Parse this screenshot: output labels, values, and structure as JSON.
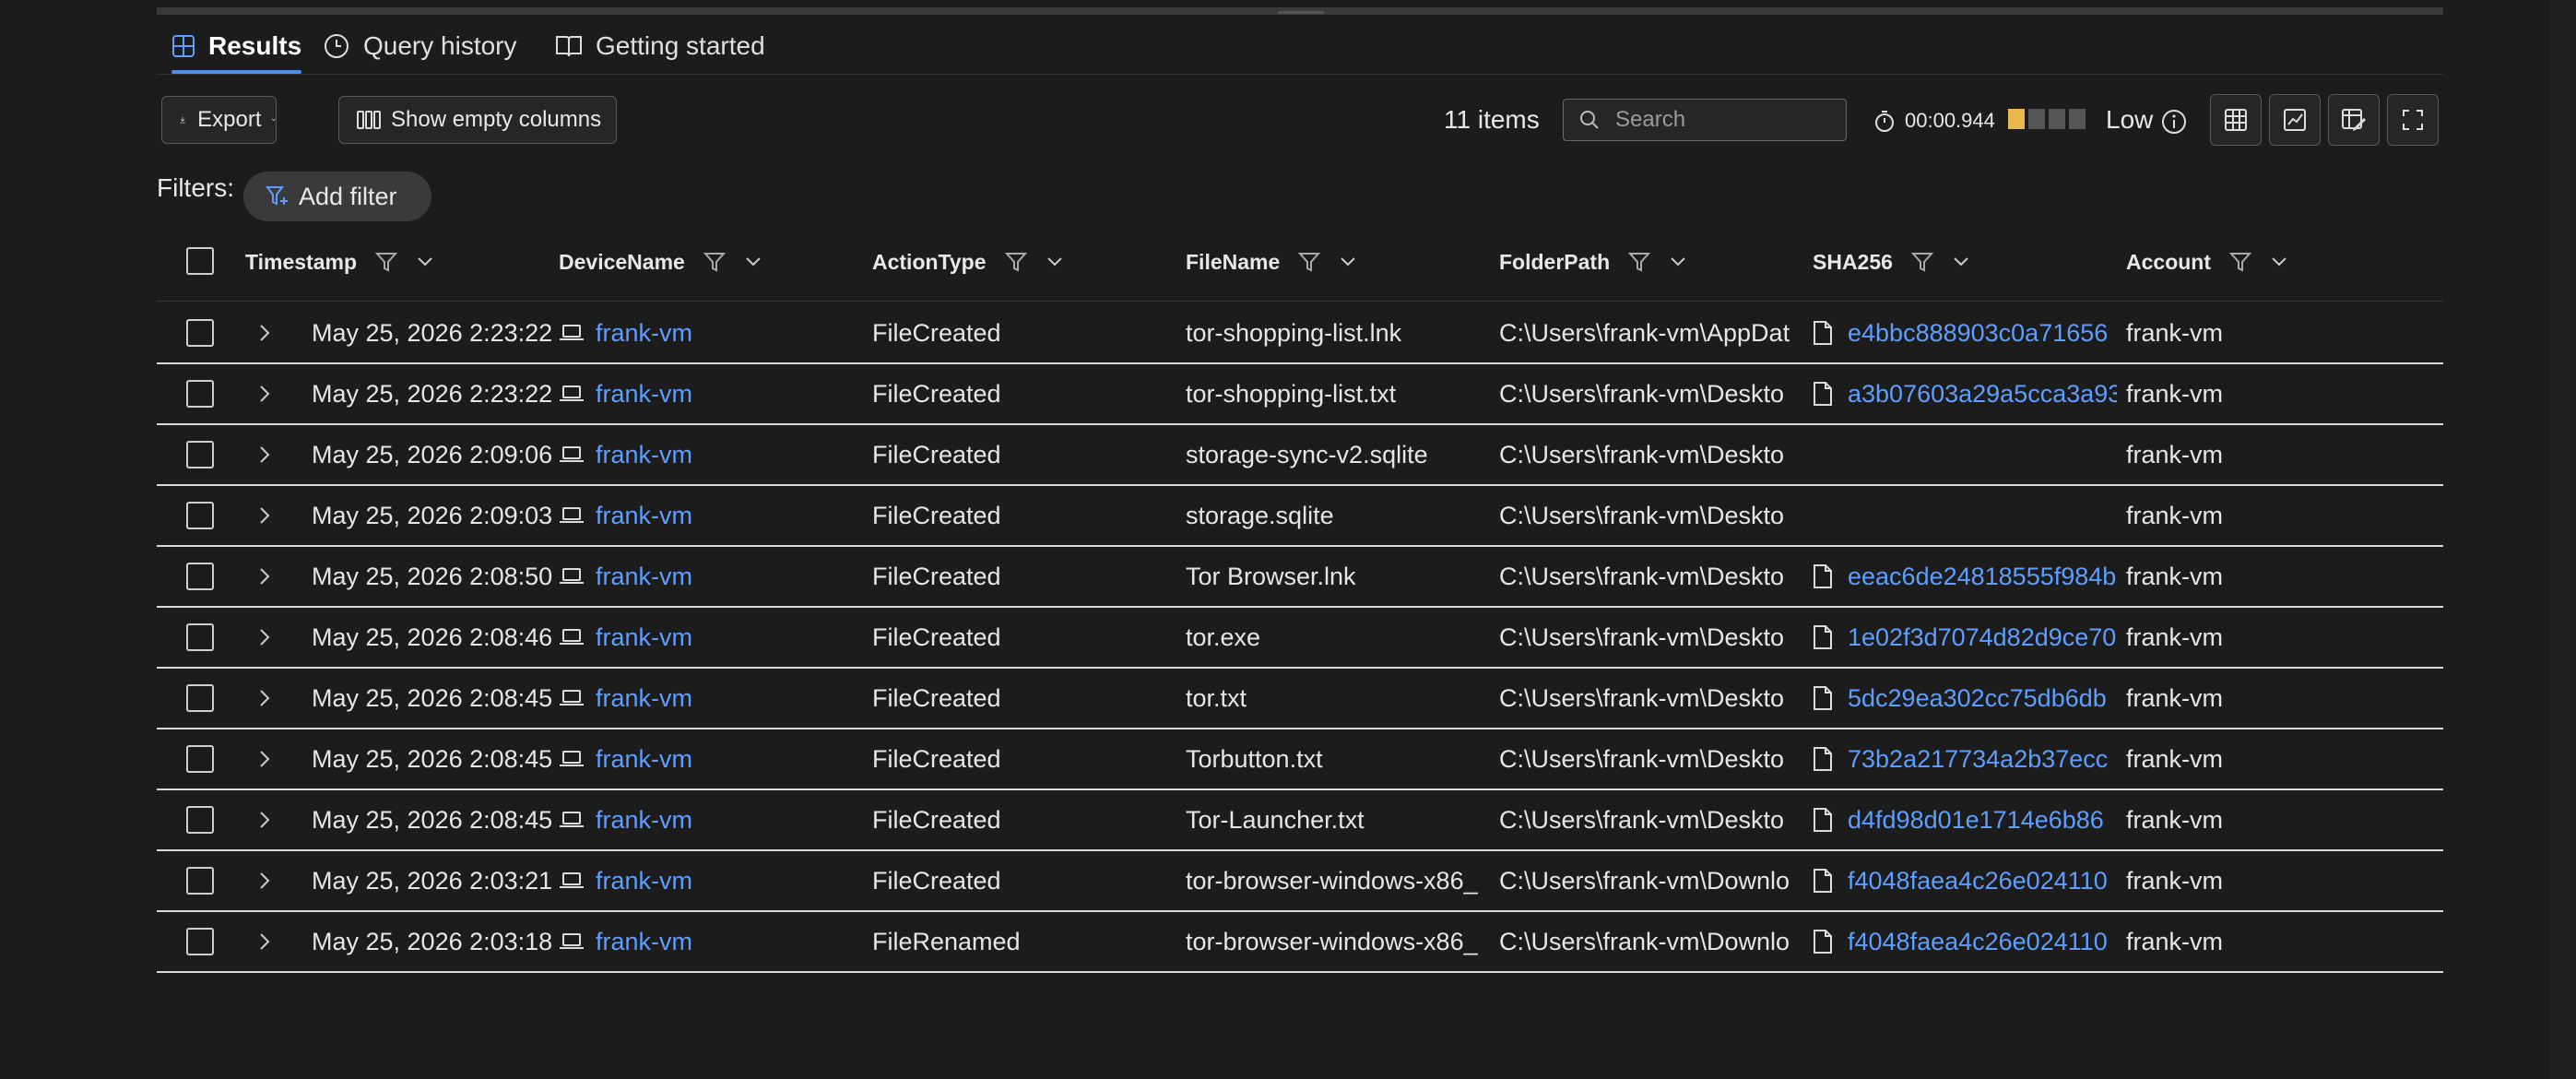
{
  "tabs": [
    {
      "label": "Results",
      "icon": "grid-icon",
      "active": true
    },
    {
      "label": "Query history",
      "icon": "clock-icon",
      "active": false
    },
    {
      "label": "Getting started",
      "icon": "book-icon",
      "active": false
    }
  ],
  "toolbar": {
    "export_label": "Export",
    "show_empty_label": "Show empty columns",
    "items_count": "11 items",
    "search_placeholder": "Search",
    "timer": "00:00.944",
    "usage_label": "Low",
    "usage_level": 1,
    "usage_max": 4,
    "accent": "#e8b84a"
  },
  "filters": {
    "label": "Filters:",
    "add_label": "Add filter"
  },
  "columns": [
    "Timestamp",
    "DeviceName",
    "ActionType",
    "FileName",
    "FolderPath",
    "SHA256",
    "Account"
  ],
  "rows": [
    {
      "timestamp": "May 25, 2026 2:23:22",
      "device": "frank-vm",
      "action": "FileCreated",
      "file": "tor-shopping-list.lnk",
      "folder": "C:\\Users\\frank-vm\\AppDat",
      "sha": "e4bbc888903c0a71656",
      "account": "frank-vm"
    },
    {
      "timestamp": "May 25, 2026 2:23:22",
      "device": "frank-vm",
      "action": "FileCreated",
      "file": "tor-shopping-list.txt",
      "folder": "C:\\Users\\frank-vm\\Deskto",
      "sha": "a3b07603a29a5cca3a93",
      "account": "frank-vm"
    },
    {
      "timestamp": "May 25, 2026 2:09:06",
      "device": "frank-vm",
      "action": "FileCreated",
      "file": "storage-sync-v2.sqlite",
      "folder": "C:\\Users\\frank-vm\\Deskto",
      "sha": "",
      "account": "frank-vm"
    },
    {
      "timestamp": "May 25, 2026 2:09:03",
      "device": "frank-vm",
      "action": "FileCreated",
      "file": "storage.sqlite",
      "folder": "C:\\Users\\frank-vm\\Deskto",
      "sha": "",
      "account": "frank-vm"
    },
    {
      "timestamp": "May 25, 2026 2:08:50",
      "device": "frank-vm",
      "action": "FileCreated",
      "file": "Tor Browser.lnk",
      "folder": "C:\\Users\\frank-vm\\Deskto",
      "sha": "eeac6de24818555f984b",
      "account": "frank-vm"
    },
    {
      "timestamp": "May 25, 2026 2:08:46",
      "device": "frank-vm",
      "action": "FileCreated",
      "file": "tor.exe",
      "folder": "C:\\Users\\frank-vm\\Deskto",
      "sha": "1e02f3d7074d82d9ce70",
      "account": "frank-vm"
    },
    {
      "timestamp": "May 25, 2026 2:08:45",
      "device": "frank-vm",
      "action": "FileCreated",
      "file": "tor.txt",
      "folder": "C:\\Users\\frank-vm\\Deskto",
      "sha": "5dc29ea302cc75db6db",
      "account": "frank-vm"
    },
    {
      "timestamp": "May 25, 2026 2:08:45",
      "device": "frank-vm",
      "action": "FileCreated",
      "file": "Torbutton.txt",
      "folder": "C:\\Users\\frank-vm\\Deskto",
      "sha": "73b2a217734a2b37ecc",
      "account": "frank-vm"
    },
    {
      "timestamp": "May 25, 2026 2:08:45",
      "device": "frank-vm",
      "action": "FileCreated",
      "file": "Tor-Launcher.txt",
      "folder": "C:\\Users\\frank-vm\\Deskto",
      "sha": "d4fd98d01e1714e6b86",
      "account": "frank-vm"
    },
    {
      "timestamp": "May 25, 2026 2:03:21",
      "device": "frank-vm",
      "action": "FileCreated",
      "file": "tor-browser-windows-x86_",
      "folder": "C:\\Users\\frank-vm\\Downlo",
      "sha": "f4048faea4c26e024110",
      "account": "frank-vm"
    },
    {
      "timestamp": "May 25, 2026 2:03:18",
      "device": "frank-vm",
      "action": "FileRenamed",
      "file": "tor-browser-windows-x86_",
      "folder": "C:\\Users\\frank-vm\\Downlo",
      "sha": "f4048faea4c26e024110",
      "account": "frank-vm"
    }
  ]
}
